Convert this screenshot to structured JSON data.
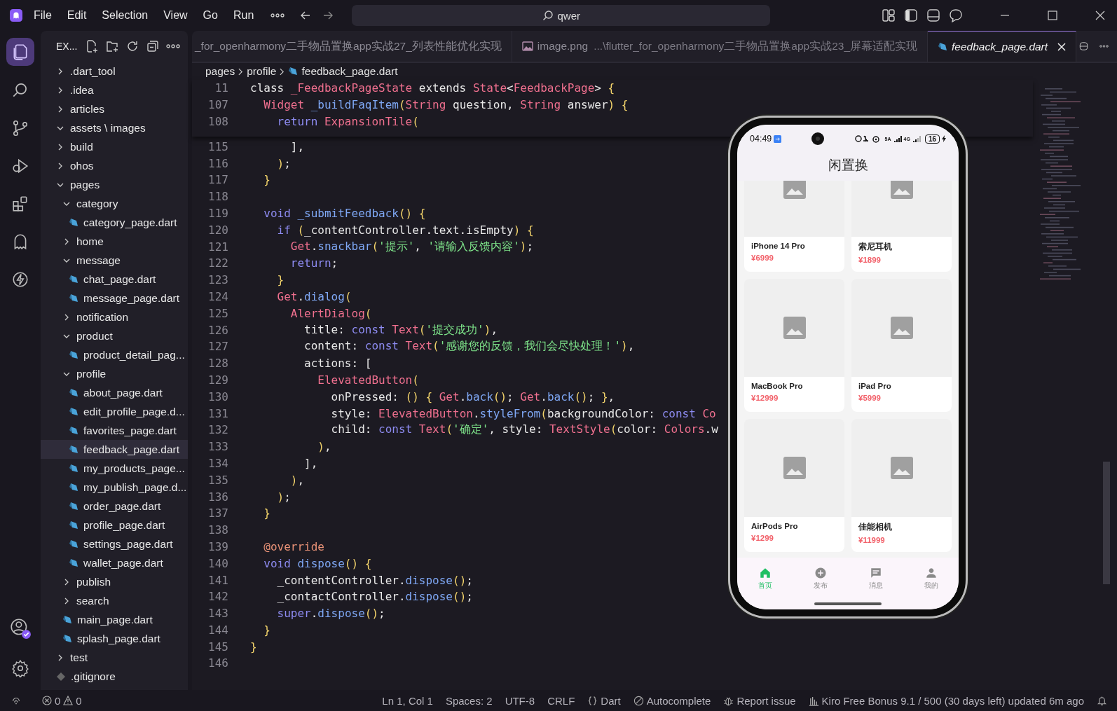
{
  "menu": [
    "File",
    "Edit",
    "Selection",
    "View",
    "Go",
    "Run"
  ],
  "search": {
    "value": "qwer"
  },
  "sidebar": {
    "title": "EX...",
    "tree": [
      {
        "label": ".dart_tool",
        "kind": "folder",
        "expanded": false,
        "selected": false
      },
      {
        "label": ".idea",
        "kind": "folder",
        "expanded": false,
        "selected": false
      },
      {
        "label": "articles",
        "kind": "folder",
        "expanded": false,
        "selected": false
      },
      {
        "label": "assets \\ images",
        "kind": "folder",
        "expanded": true,
        "selected": false
      },
      {
        "label": "build",
        "kind": "folder",
        "expanded": false,
        "selected": false
      },
      {
        "label": "ohos",
        "kind": "folder",
        "expanded": false,
        "selected": false
      },
      {
        "label": "pages",
        "kind": "folder",
        "expanded": true,
        "selected": false,
        "children": [
          {
            "label": "category",
            "kind": "folder",
            "expanded": true,
            "selected": false,
            "children": [
              {
                "label": "category_page.dart",
                "kind": "dart",
                "selected": false
              }
            ]
          },
          {
            "label": "home",
            "kind": "folder",
            "expanded": false,
            "selected": false
          },
          {
            "label": "message",
            "kind": "folder",
            "expanded": true,
            "selected": false,
            "children": [
              {
                "label": "chat_page.dart",
                "kind": "dart",
                "selected": false
              },
              {
                "label": "message_page.dart",
                "kind": "dart",
                "selected": false
              }
            ]
          },
          {
            "label": "notification",
            "kind": "folder",
            "expanded": false,
            "selected": false
          },
          {
            "label": "product",
            "kind": "folder",
            "expanded": true,
            "selected": false,
            "children": [
              {
                "label": "product_detail_pag...",
                "kind": "dart",
                "selected": false
              }
            ]
          },
          {
            "label": "profile",
            "kind": "folder",
            "expanded": true,
            "selected": false,
            "children": [
              {
                "label": "about_page.dart",
                "kind": "dart",
                "selected": false
              },
              {
                "label": "edit_profile_page.d...",
                "kind": "dart",
                "selected": false
              },
              {
                "label": "favorites_page.dart",
                "kind": "dart",
                "selected": false
              },
              {
                "label": "feedback_page.dart",
                "kind": "dart",
                "selected": true
              },
              {
                "label": "my_products_page...",
                "kind": "dart",
                "selected": false
              },
              {
                "label": "my_publish_page.d...",
                "kind": "dart",
                "selected": false
              },
              {
                "label": "order_page.dart",
                "kind": "dart",
                "selected": false
              },
              {
                "label": "profile_page.dart",
                "kind": "dart",
                "selected": false
              },
              {
                "label": "settings_page.dart",
                "kind": "dart",
                "selected": false
              },
              {
                "label": "wallet_page.dart",
                "kind": "dart",
                "selected": false
              }
            ]
          },
          {
            "label": "publish",
            "kind": "folder",
            "expanded": false,
            "selected": false
          },
          {
            "label": "search",
            "kind": "folder",
            "expanded": false,
            "selected": false
          },
          {
            "label": "main_page.dart",
            "kind": "dart",
            "selected": false
          },
          {
            "label": "splash_page.dart",
            "kind": "dart",
            "selected": false
          }
        ]
      },
      {
        "label": "test",
        "kind": "folder",
        "expanded": false,
        "selected": false
      },
      {
        "label": ".gitignore",
        "kind": "file",
        "selected": false
      }
    ]
  },
  "tabs": [
    {
      "label": "_for_openharmony二手物品置换app实战27_列表性能优化实现",
      "kind": "plain",
      "selected": false
    },
    {
      "label": "image.png",
      "detail": "...\\flutter_for_openharmony二手物品置换app实战23_屏幕适配实现",
      "kind": "image",
      "selected": false
    },
    {
      "label": "feedback_page.dart",
      "kind": "dart",
      "selected": true
    }
  ],
  "breadcrumbs": [
    "pages",
    "profile",
    "feedback_page.dart"
  ],
  "sticky_lines": [
    {
      "number": "11",
      "tokens": [
        {
          "text": "class ",
          "kind": "plain"
        },
        {
          "text": "_FeedbackPageState",
          "kind": "type"
        },
        {
          "text": " extends ",
          "kind": "plain"
        },
        {
          "text": "State",
          "kind": "type"
        },
        {
          "text": "<",
          "kind": "plain"
        },
        {
          "text": "FeedbackPage",
          "kind": "type"
        },
        {
          "text": "> ",
          "kind": "plain"
        },
        {
          "text": "{",
          "kind": "bracket"
        }
      ]
    },
    {
      "number": "107",
      "tokens": [
        {
          "text": "  Widget",
          "kind": "type"
        },
        {
          "text": " _buildFaqItem",
          "kind": "function"
        },
        {
          "text": "(",
          "kind": "bracket"
        },
        {
          "text": "String",
          "kind": "type"
        },
        {
          "text": " question, ",
          "kind": "plain"
        },
        {
          "text": "String",
          "kind": "type"
        },
        {
          "text": " answer",
          "kind": "plain"
        },
        {
          "text": ")",
          "kind": "bracket"
        },
        {
          "text": " {",
          "kind": "bracket"
        }
      ]
    },
    {
      "number": "108",
      "tokens": [
        {
          "text": "    return",
          "kind": "keyword"
        },
        {
          "text": " ExpansionTile",
          "kind": "type"
        },
        {
          "text": "(",
          "kind": "bracket"
        }
      ]
    }
  ],
  "lines": [
    {
      "number": "115",
      "tokens": [
        {
          "text": "      ],",
          "kind": "plain"
        }
      ]
    },
    {
      "number": "116",
      "tokens": [
        {
          "text": "    )",
          "kind": "bracket"
        },
        {
          "text": ";",
          "kind": "plain"
        }
      ]
    },
    {
      "number": "117",
      "tokens": [
        {
          "text": "  }",
          "kind": "bracket"
        }
      ]
    },
    {
      "number": "118"
    },
    {
      "number": "119",
      "tokens": [
        {
          "text": "  void",
          "kind": "keyword"
        },
        {
          "text": " _submitFeedback",
          "kind": "function"
        },
        {
          "text": "()",
          "kind": "bracket"
        },
        {
          "text": " {",
          "kind": "bracket"
        }
      ]
    },
    {
      "number": "120",
      "tokens": [
        {
          "text": "    if",
          "kind": "keyword"
        },
        {
          "text": " (",
          "kind": "bracket"
        },
        {
          "text": "_contentController.text.isEmpty",
          "kind": "plain"
        },
        {
          "text": ")",
          "kind": "bracket"
        },
        {
          "text": " {",
          "kind": "bracket"
        }
      ]
    },
    {
      "number": "121",
      "tokens": [
        {
          "text": "      Get",
          "kind": "type"
        },
        {
          "text": ".",
          "kind": "plain"
        },
        {
          "text": "snackbar",
          "kind": "function"
        },
        {
          "text": "(",
          "kind": "bracket"
        },
        {
          "text": "'提示'",
          "kind": "string"
        },
        {
          "text": ", ",
          "kind": "plain"
        },
        {
          "text": "'请输入反馈内容'",
          "kind": "string"
        },
        {
          "text": ")",
          "kind": "bracket"
        },
        {
          "text": ";",
          "kind": "plain"
        }
      ]
    },
    {
      "number": "122",
      "tokens": [
        {
          "text": "      return",
          "kind": "keyword"
        },
        {
          "text": ";",
          "kind": "plain"
        }
      ]
    },
    {
      "number": "123",
      "tokens": [
        {
          "text": "    }",
          "kind": "bracket"
        }
      ]
    },
    {
      "number": "124",
      "tokens": [
        {
          "text": "    Get",
          "kind": "type"
        },
        {
          "text": ".",
          "kind": "plain"
        },
        {
          "text": "dialog",
          "kind": "function"
        },
        {
          "text": "(",
          "kind": "bracket"
        }
      ]
    },
    {
      "number": "125",
      "tokens": [
        {
          "text": "      AlertDialog",
          "kind": "type"
        },
        {
          "text": "(",
          "kind": "bracket"
        }
      ]
    },
    {
      "number": "126",
      "tokens": [
        {
          "text": "        title: ",
          "kind": "plain"
        },
        {
          "text": "const",
          "kind": "keyword"
        },
        {
          "text": " Text",
          "kind": "type"
        },
        {
          "text": "(",
          "kind": "bracket"
        },
        {
          "text": "'提交成功'",
          "kind": "string"
        },
        {
          "text": ")",
          "kind": "bracket"
        },
        {
          "text": ",",
          "kind": "plain"
        }
      ]
    },
    {
      "number": "127",
      "tokens": [
        {
          "text": "        content: ",
          "kind": "plain"
        },
        {
          "text": "const",
          "kind": "keyword"
        },
        {
          "text": " Text",
          "kind": "type"
        },
        {
          "text": "(",
          "kind": "bracket"
        },
        {
          "text": "'感谢您的反馈，我们会尽快处理！'",
          "kind": "string"
        },
        {
          "text": ")",
          "kind": "bracket"
        },
        {
          "text": ",",
          "kind": "plain"
        }
      ]
    },
    {
      "number": "128",
      "tokens": [
        {
          "text": "        actions: [",
          "kind": "plain"
        }
      ]
    },
    {
      "number": "129",
      "tokens": [
        {
          "text": "          ElevatedButton",
          "kind": "type"
        },
        {
          "text": "(",
          "kind": "bracket"
        }
      ]
    },
    {
      "number": "130",
      "tokens": [
        {
          "text": "            onPressed: ",
          "kind": "plain"
        },
        {
          "text": "()",
          "kind": "bracket"
        },
        {
          "text": " {",
          "kind": "bracket"
        },
        {
          "text": " Get",
          "kind": "type"
        },
        {
          "text": ".",
          "kind": "plain"
        },
        {
          "text": "back",
          "kind": "function"
        },
        {
          "text": "()",
          "kind": "bracket"
        },
        {
          "text": "; ",
          "kind": "plain"
        },
        {
          "text": "Get",
          "kind": "type"
        },
        {
          "text": ".",
          "kind": "plain"
        },
        {
          "text": "back",
          "kind": "function"
        },
        {
          "text": "()",
          "kind": "bracket"
        },
        {
          "text": "; ",
          "kind": "plain"
        },
        {
          "text": "}",
          "kind": "bracket"
        },
        {
          "text": ",",
          "kind": "plain"
        }
      ]
    },
    {
      "number": "131",
      "tokens": [
        {
          "text": "            style: ",
          "kind": "plain"
        },
        {
          "text": "ElevatedButton",
          "kind": "type"
        },
        {
          "text": ".",
          "kind": "plain"
        },
        {
          "text": "styleFrom",
          "kind": "function"
        },
        {
          "text": "(",
          "kind": "bracket"
        },
        {
          "text": "backgroundColor: ",
          "kind": "plain"
        },
        {
          "text": "const",
          "kind": "keyword"
        },
        {
          "text": " Co",
          "kind": "type"
        }
      ]
    },
    {
      "number": "132",
      "tokens": [
        {
          "text": "            child: ",
          "kind": "plain"
        },
        {
          "text": "const",
          "kind": "keyword"
        },
        {
          "text": " Text",
          "kind": "type"
        },
        {
          "text": "(",
          "kind": "bracket"
        },
        {
          "text": "'确定'",
          "kind": "string"
        },
        {
          "text": ", style: ",
          "kind": "plain"
        },
        {
          "text": "TextStyle",
          "kind": "type"
        },
        {
          "text": "(",
          "kind": "bracket"
        },
        {
          "text": "color: ",
          "kind": "plain"
        },
        {
          "text": "Colors",
          "kind": "type"
        },
        {
          "text": ".w",
          "kind": "plain"
        }
      ]
    },
    {
      "number": "133",
      "tokens": [
        {
          "text": "          )",
          "kind": "bracket"
        },
        {
          "text": ",",
          "kind": "plain"
        }
      ]
    },
    {
      "number": "134",
      "tokens": [
        {
          "text": "        ],",
          "kind": "plain"
        }
      ]
    },
    {
      "number": "135",
      "tokens": [
        {
          "text": "      )",
          "kind": "bracket"
        },
        {
          "text": ",",
          "kind": "plain"
        }
      ]
    },
    {
      "number": "136",
      "tokens": [
        {
          "text": "    )",
          "kind": "bracket"
        },
        {
          "text": ";",
          "kind": "plain"
        }
      ]
    },
    {
      "number": "137",
      "tokens": [
        {
          "text": "  }",
          "kind": "bracket"
        }
      ]
    },
    {
      "number": "138"
    },
    {
      "number": "139",
      "tokens": [
        {
          "text": "  @override",
          "kind": "annotation"
        }
      ]
    },
    {
      "number": "140",
      "tokens": [
        {
          "text": "  void",
          "kind": "keyword"
        },
        {
          "text": " dispose",
          "kind": "function"
        },
        {
          "text": "()",
          "kind": "bracket"
        },
        {
          "text": " {",
          "kind": "bracket"
        }
      ]
    },
    {
      "number": "141",
      "tokens": [
        {
          "text": "    _contentController.",
          "kind": "plain"
        },
        {
          "text": "dispose",
          "kind": "function"
        },
        {
          "text": "()",
          "kind": "bracket"
        },
        {
          "text": ";",
          "kind": "plain"
        }
      ]
    },
    {
      "number": "142",
      "tokens": [
        {
          "text": "    _contactController.",
          "kind": "plain"
        },
        {
          "text": "dispose",
          "kind": "function"
        },
        {
          "text": "()",
          "kind": "bracket"
        },
        {
          "text": ";",
          "kind": "plain"
        }
      ]
    },
    {
      "number": "143",
      "tokens": [
        {
          "text": "    super",
          "kind": "keyword"
        },
        {
          "text": ".",
          "kind": "plain"
        },
        {
          "text": "dispose",
          "kind": "function"
        },
        {
          "text": "()",
          "kind": "bracket"
        },
        {
          "text": ";",
          "kind": "plain"
        }
      ]
    },
    {
      "number": "144",
      "tokens": [
        {
          "text": "  }",
          "kind": "bracket"
        }
      ]
    },
    {
      "number": "145",
      "tokens": [
        {
          "text": "}",
          "kind": "bracket"
        }
      ]
    },
    {
      "number": "146"
    }
  ],
  "phone": {
    "time": "04:49",
    "network": [
      "5A",
      "4G"
    ],
    "battery": "16",
    "title": "闲置换",
    "products": [
      {
        "name": "iPhone 14 Pro",
        "price": "¥6999"
      },
      {
        "name": "索尼耳机",
        "price": "¥1899"
      },
      {
        "name": "MacBook Pro",
        "price": "¥12999"
      },
      {
        "name": "iPad Pro",
        "price": "¥5999"
      },
      {
        "name": "AirPods Pro",
        "price": "¥1299"
      },
      {
        "name": "佳能相机",
        "price": "¥11999"
      }
    ],
    "nav": [
      {
        "label": "首页",
        "kind": "home",
        "selected": true
      },
      {
        "label": "发布",
        "kind": "add",
        "selected": false
      },
      {
        "label": "消息",
        "kind": "chat",
        "selected": false
      },
      {
        "label": "我的",
        "kind": "person",
        "selected": false
      }
    ]
  },
  "status_bar": {
    "errors": "0",
    "warnings": "0",
    "position": "Ln 1, Col 1",
    "spaces": "Spaces: 2",
    "encoding": "UTF-8",
    "eol": "CRLF",
    "language": "Dart",
    "autocomplete": "Autocomplete",
    "report": "Report issue",
    "usage": "Kiro Free Bonus 9.1 / 500 (30 days left) updated 6m ago"
  }
}
